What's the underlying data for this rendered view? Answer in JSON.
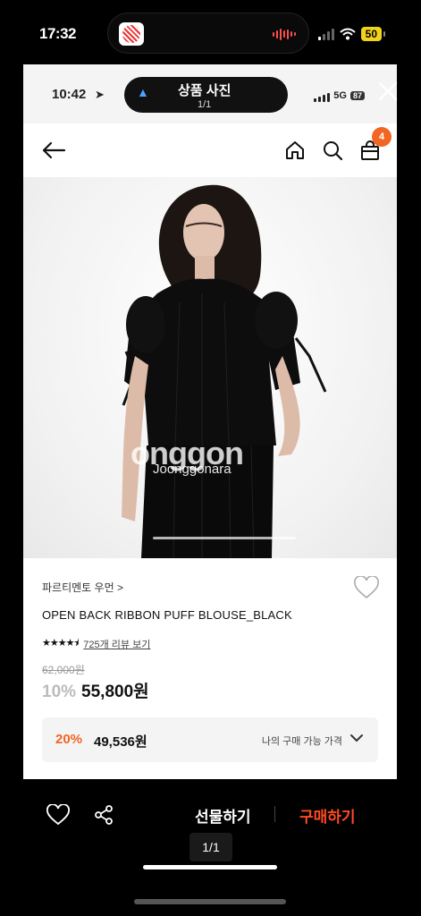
{
  "outer_status": {
    "time": "17:32",
    "battery": "50"
  },
  "inner_status": {
    "time": "10:42",
    "network": "5G",
    "battery": "87"
  },
  "photo_viewer": {
    "title": "상품 사진",
    "counter": "1/1"
  },
  "header": {
    "cart_count": "4"
  },
  "photo": {
    "watermark": "Joonggonara",
    "watermark_big": "onggon"
  },
  "product": {
    "brand": "파르티멘토 우먼 >",
    "name": "OPEN BACK RIBBON PUFF BLOUSE_BLACK",
    "rating": 4.5,
    "review_link": "725개 리뷰 보기",
    "original_price": "62,000원",
    "discount_rate": "10%",
    "price": "55,800원",
    "my_rate": "20%",
    "my_price": "49,536원",
    "my_label": "나의 구매 가능 가격"
  },
  "bottom_bar": {
    "gift_label": "선물하기",
    "buy_label": "구매하기",
    "page_indicator": "1/1"
  },
  "colors": {
    "accent": "#f26522",
    "buy": "#ff4a24"
  }
}
